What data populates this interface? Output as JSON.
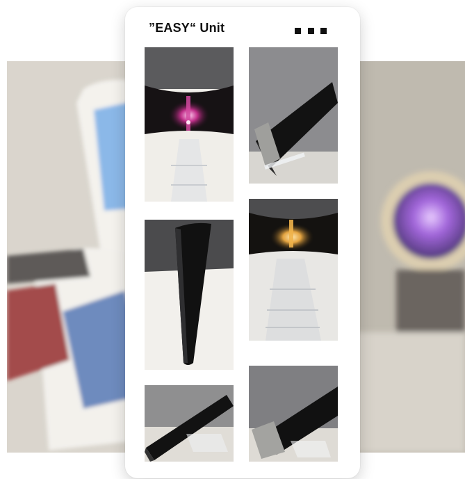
{
  "header": {
    "title": "”EASY“ Unit",
    "more_icon": "more-dots-icon"
  },
  "gallery": {
    "photos": [
      {
        "subject": "light-slit-pink"
      },
      {
        "subject": "black-bar-foam-end"
      },
      {
        "subject": "curved-black-panel"
      },
      {
        "subject": "light-slit-amber"
      },
      {
        "subject": "black-bar-angled"
      },
      {
        "subject": "black-bar-foam-cap"
      }
    ]
  },
  "colors": {
    "accent_pink": "#c0308a",
    "accent_amber": "#e3a340",
    "card_bg": "#ffffff",
    "title_text": "#111111"
  }
}
